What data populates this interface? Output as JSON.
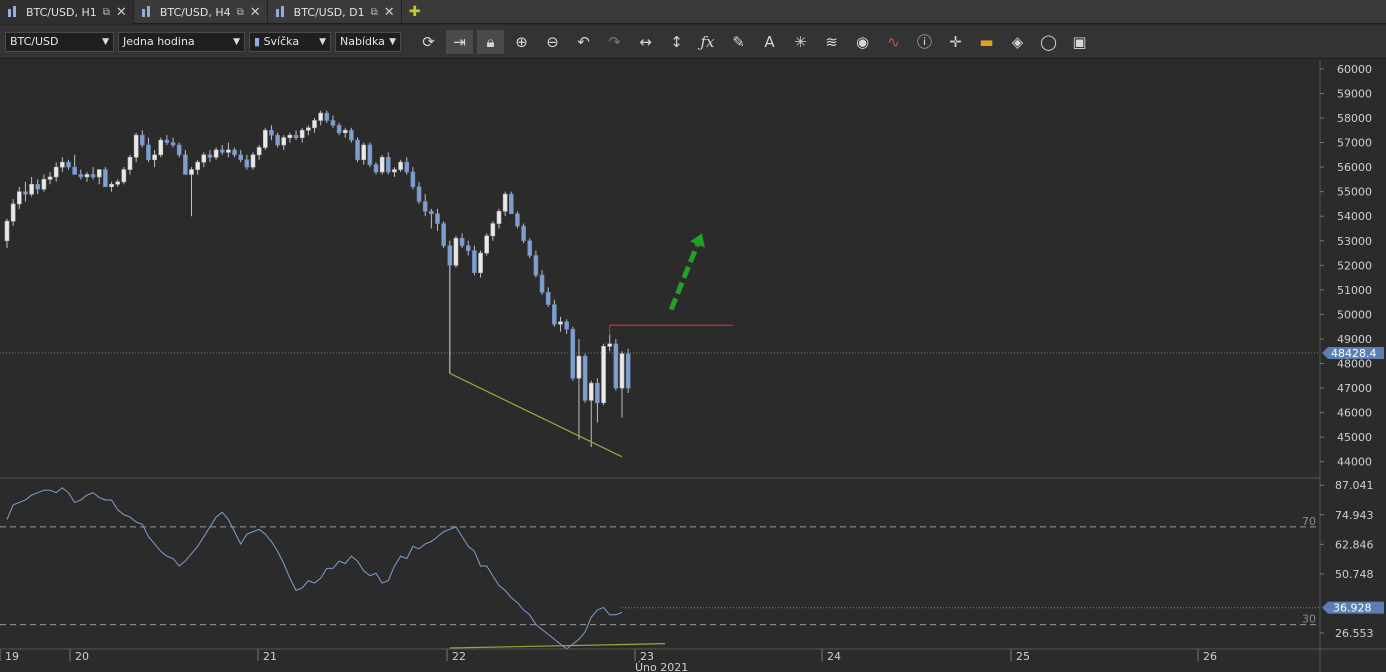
{
  "tabs": [
    {
      "label": "BTC/USD, H1",
      "active": true
    },
    {
      "label": "BTC/USD, H4",
      "active": false
    },
    {
      "label": "BTC/USD, D1",
      "active": false
    }
  ],
  "toolbar": {
    "symbol": "BTC/USD",
    "timeframe": "Jedna hodina",
    "chart_type": "Svíčka",
    "price_type": "Nabídka",
    "buttons": [
      "refresh-icon",
      "autoscroll-icon",
      "lock-icon",
      "zoom-in-icon",
      "zoom-out-icon",
      "undo-icon",
      "redo-icon",
      "horizontal-resize-icon",
      "vertical-resize-icon",
      "fx-icon",
      "pencil-icon",
      "text-icon",
      "crosshair-icon",
      "layers-icon",
      "eye-icon",
      "indicator-icon",
      "info-icon",
      "cursor-icon",
      "color-icon",
      "paint-bucket-icon",
      "circle-icon",
      "save-icon"
    ]
  },
  "chart_data": [
    {
      "type": "candlestick",
      "symbol": "BTC/USD",
      "timeframe": "H1",
      "ylim": [
        43500,
        60200
      ],
      "y_ticks": [
        60000,
        59000,
        58000,
        57000,
        56000,
        55000,
        54000,
        53000,
        52000,
        51000,
        50000,
        49000,
        48000,
        47000,
        46000,
        45000,
        44000
      ],
      "current_price": "48428.4",
      "x_axis": {
        "day_labels": [
          "19",
          "20",
          "21",
          "22",
          "23",
          "24",
          "25",
          "26"
        ],
        "month_label": "Úno 2021"
      },
      "series": [
        {
          "name": "price",
          "values": [
            [
              53000,
              53900,
              52700,
              53800
            ],
            [
              53800,
              54700,
              53600,
              54500
            ],
            [
              54500,
              55200,
              54300,
              55000
            ],
            [
              55000,
              55400,
              54600,
              54900
            ],
            [
              54900,
              55600,
              54800,
              55300
            ],
            [
              55300,
              55500,
              54900,
              55100
            ],
            [
              55100,
              55700,
              55000,
              55500
            ],
            [
              55500,
              55800,
              55300,
              55600
            ],
            [
              55600,
              56200,
              55400,
              56000
            ],
            [
              56000,
              56400,
              55800,
              56200
            ],
            [
              56200,
              56300,
              55900,
              56000
            ],
            [
              56000,
              56500,
              55800,
              55700
            ],
            [
              55700,
              55900,
              55500,
              55600
            ],
            [
              55600,
              55800,
              55400,
              55700
            ],
            [
              55700,
              56000,
              55500,
              55600
            ],
            [
              55600,
              55800,
              55300,
              55900
            ],
            [
              55900,
              56000,
              55200,
              55200
            ],
            [
              55200,
              55400,
              55000,
              55300
            ],
            [
              55300,
              55500,
              55200,
              55400
            ],
            [
              55400,
              56000,
              55300,
              55900
            ],
            [
              55900,
              56500,
              55700,
              56400
            ],
            [
              56400,
              57400,
              56200,
              57300
            ],
            [
              57300,
              57500,
              56800,
              56900
            ],
            [
              56900,
              57200,
              56200,
              56300
            ],
            [
              56300,
              56700,
              56000,
              56500
            ],
            [
              56500,
              57200,
              56400,
              57100
            ],
            [
              57100,
              57300,
              56900,
              57000
            ],
            [
              57000,
              57200,
              56800,
              56900
            ],
            [
              56900,
              57000,
              56400,
              56500
            ],
            [
              56500,
              56700,
              55800,
              55700
            ],
            [
              55700,
              56000,
              54000,
              55900
            ],
            [
              55900,
              56300,
              55700,
              56200
            ],
            [
              56200,
              56600,
              56000,
              56500
            ],
            [
              56500,
              56700,
              56200,
              56400
            ],
            [
              56400,
              56800,
              56300,
              56700
            ],
            [
              56700,
              56900,
              56500,
              56600
            ],
            [
              56600,
              57000,
              56400,
              56700
            ],
            [
              56700,
              56800,
              56400,
              56500
            ],
            [
              56500,
              56700,
              56200,
              56300
            ],
            [
              56300,
              56500,
              55900,
              56000
            ],
            [
              56000,
              56600,
              55900,
              56500
            ],
            [
              56500,
              56900,
              56300,
              56800
            ],
            [
              56800,
              57600,
              56700,
              57500
            ],
            [
              57500,
              57700,
              57100,
              57300
            ],
            [
              57300,
              57400,
              56800,
              56900
            ],
            [
              56900,
              57300,
              56700,
              57200
            ],
            [
              57200,
              57400,
              57000,
              57300
            ],
            [
              57300,
              57500,
              57100,
              57200
            ],
            [
              57200,
              57600,
              57000,
              57500
            ],
            [
              57500,
              57700,
              57300,
              57600
            ],
            [
              57600,
              58000,
              57400,
              57900
            ],
            [
              57900,
              58300,
              57700,
              58200
            ],
            [
              58200,
              58300,
              57800,
              57900
            ],
            [
              57900,
              58100,
              57600,
              57700
            ],
            [
              57700,
              57800,
              57300,
              57400
            ],
            [
              57400,
              57600,
              57200,
              57500
            ],
            [
              57500,
              57600,
              57000,
              57100
            ],
            [
              57100,
              57200,
              56200,
              56300
            ],
            [
              56300,
              57000,
              56100,
              56900
            ],
            [
              56900,
              57000,
              56000,
              56100
            ],
            [
              56100,
              56200,
              55700,
              55800
            ],
            [
              55800,
              56500,
              55700,
              56400
            ],
            [
              56400,
              56600,
              55700,
              55800
            ],
            [
              55800,
              56000,
              55600,
              55900
            ],
            [
              55900,
              56300,
              55800,
              56200
            ],
            [
              56200,
              56400,
              55700,
              55800
            ],
            [
              55800,
              56000,
              55100,
              55200
            ],
            [
              55200,
              55400,
              54500,
              54600
            ],
            [
              54600,
              54900,
              54000,
              54200
            ],
            [
              54200,
              54300,
              53500,
              54100
            ],
            [
              54100,
              54300,
              53400,
              53700
            ],
            [
              53700,
              53800,
              52700,
              52800
            ],
            [
              52800,
              53000,
              47600,
              52000
            ],
            [
              52000,
              53200,
              51900,
              53100
            ],
            [
              53100,
              53300,
              52700,
              52800
            ],
            [
              52800,
              53000,
              52400,
              52600
            ],
            [
              52600,
              52800,
              51600,
              51700
            ],
            [
              51700,
              52600,
              51500,
              52500
            ],
            [
              52500,
              53300,
              52400,
              53200
            ],
            [
              53200,
              53800,
              53000,
              53700
            ],
            [
              53700,
              54300,
              53500,
              54200
            ],
            [
              54200,
              55000,
              54000,
              54900
            ],
            [
              54900,
              55000,
              54300,
              54100
            ],
            [
              54100,
              54200,
              53500,
              53600
            ],
            [
              53600,
              53700,
              52900,
              53000
            ],
            [
              53000,
              53100,
              52300,
              52400
            ],
            [
              52400,
              52600,
              51500,
              51600
            ],
            [
              51600,
              51800,
              50800,
              50900
            ],
            [
              50900,
              51100,
              50300,
              50400
            ],
            [
              50400,
              50600,
              49500,
              49600
            ],
            [
              49600,
              49900,
              49300,
              49700
            ],
            [
              49700,
              49800,
              49200,
              49400
            ],
            [
              49400,
              49500,
              47300,
              47400
            ],
            [
              47400,
              49000,
              44900,
              48300
            ],
            [
              48300,
              48400,
              46400,
              46500
            ],
            [
              46500,
              47300,
              44600,
              47200
            ],
            [
              47200,
              47400,
              45600,
              46400
            ],
            [
              46400,
              48800,
              46300,
              48700
            ],
            [
              48700,
              49200,
              48500,
              48800
            ],
            [
              48800,
              49000,
              46900,
              47000
            ],
            [
              47000,
              48500,
              45800,
              48400
            ],
            [
              48400,
              48600,
              46800,
              47000
            ]
          ]
        }
      ],
      "annotations": [
        {
          "type": "trendline",
          "color": "#9aa73c",
          "points": [
            [
              72,
              47600
            ],
            [
              100,
              44200
            ]
          ]
        },
        {
          "type": "horizontal-segment",
          "color": "#c83232",
          "y": 49560,
          "x_range": [
            98,
            118
          ]
        },
        {
          "type": "arrow",
          "color": "#22a02a",
          "style": "dashed",
          "from": [
            108,
            50200
          ],
          "to": [
            113,
            53300
          ]
        }
      ]
    },
    {
      "type": "line",
      "name": "RSI",
      "ylim": [
        20,
        90
      ],
      "y_ticks": [
        "87.041",
        "74.943",
        "62.846",
        "50.748",
        "26.553"
      ],
      "levels": [
        {
          "value": 70,
          "label": "70"
        },
        {
          "value": 30,
          "label": "30"
        }
      ],
      "current_value": "36.928",
      "values": [
        73,
        79,
        80,
        81,
        83,
        84,
        85,
        85,
        84,
        86,
        84,
        80,
        81,
        83,
        84,
        82,
        81,
        81,
        77,
        75,
        74,
        72,
        71,
        66,
        63,
        60,
        58,
        57,
        54,
        56,
        59,
        62,
        66,
        70,
        74,
        76,
        73,
        68,
        63,
        67,
        68,
        69,
        67,
        64,
        60,
        55,
        49,
        44,
        45,
        48,
        47,
        49,
        53,
        53,
        56,
        55,
        58,
        56,
        52,
        50,
        51,
        47,
        48,
        54,
        58,
        57,
        62,
        61,
        63,
        64,
        66,
        68,
        69,
        70,
        66,
        62,
        60,
        54,
        54,
        50,
        46,
        44,
        41,
        39,
        36,
        34,
        30,
        28,
        26,
        24,
        22,
        20,
        22,
        24,
        27,
        33,
        36,
        37,
        34,
        34,
        35
      ],
      "annotations": [
        {
          "type": "trendline",
          "color": "#9aa73c",
          "points": [
            [
              72,
              20.4
            ],
            [
              107,
              22.2
            ]
          ]
        },
        {
          "type": "dotted-segment",
          "color": "#888888",
          "y": 36.9,
          "x_range": [
            100,
            175
          ]
        }
      ]
    }
  ]
}
